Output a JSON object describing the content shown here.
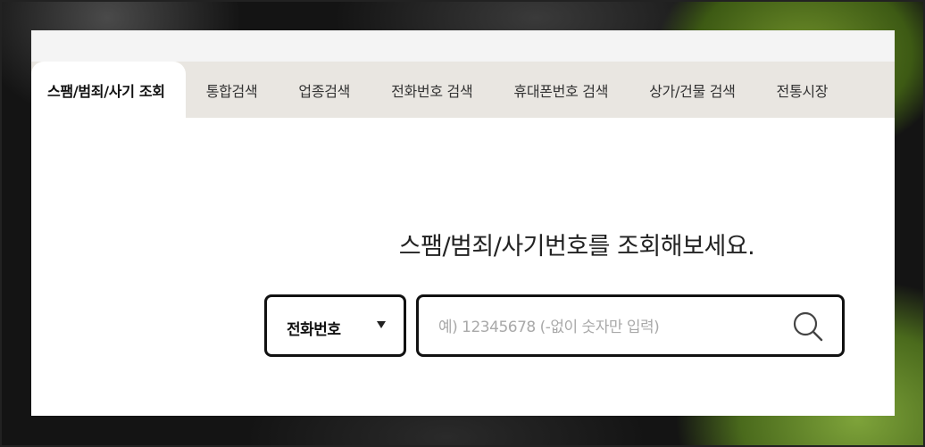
{
  "tabs": [
    {
      "label": "스팸/범죄/사기 조회",
      "active": true
    },
    {
      "label": "통합검색"
    },
    {
      "label": "업종검색"
    },
    {
      "label": "전화번호 검색"
    },
    {
      "label": "휴대폰번호 검색"
    },
    {
      "label": "상가/건물 검색"
    },
    {
      "label": "전통시장"
    }
  ],
  "main": {
    "headline": "스팸/범죄/사기번호를 조회해보세요."
  },
  "search": {
    "type_selected": "전화번호",
    "placeholder": "예) 12345678 (-없이 숫자만 입력)",
    "value": ""
  },
  "icons": {
    "search": "search-icon",
    "dropdown": "caret-down-icon"
  },
  "colors": {
    "tab_bar": "#e9e6e1",
    "border": "#111111",
    "placeholder": "#a9a9a9"
  }
}
